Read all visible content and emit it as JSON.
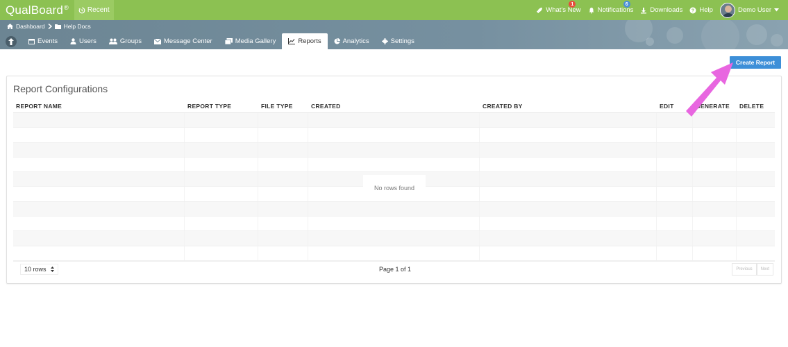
{
  "app": {
    "brand": "QualBoard",
    "brand_mark": "®",
    "recent_label": "Recent"
  },
  "topnav": {
    "whats_new": {
      "label": "What's New",
      "badge": "1"
    },
    "notifications": {
      "label": "Notifications",
      "badge": "6"
    },
    "downloads_label": "Downloads",
    "help_label": "Help",
    "user_label": "Demo User"
  },
  "breadcrumb": {
    "dashboard": "Dashboard",
    "current": "Help Docs"
  },
  "tabs": [
    {
      "label": "Events",
      "icon": "calendar-icon"
    },
    {
      "label": "Users",
      "icon": "user-icon"
    },
    {
      "label": "Groups",
      "icon": "group-icon"
    },
    {
      "label": "Message Center",
      "icon": "envelope-icon"
    },
    {
      "label": "Media Gallery",
      "icon": "images-icon"
    },
    {
      "label": "Reports",
      "icon": "chart-icon",
      "active": true
    },
    {
      "label": "Analytics",
      "icon": "pie-icon"
    },
    {
      "label": "Settings",
      "icon": "gear-icon"
    }
  ],
  "create_report_label": "Create Report",
  "panel": {
    "title": "Report Configurations",
    "columns": [
      "REPORT NAME",
      "REPORT TYPE",
      "FILE TYPE",
      "CREATED",
      "CREATED BY",
      "EDIT",
      "GENERATE",
      "DELETE"
    ],
    "empty_text": "No rows found",
    "rows_select": "10 rows",
    "page_info": "Page 1 of 1",
    "prev_label": "Previous",
    "next_label": "Next"
  },
  "colors": {
    "topbar": "#8cc152",
    "accent": "#3d8fd8",
    "arrow": "#e866e0"
  }
}
